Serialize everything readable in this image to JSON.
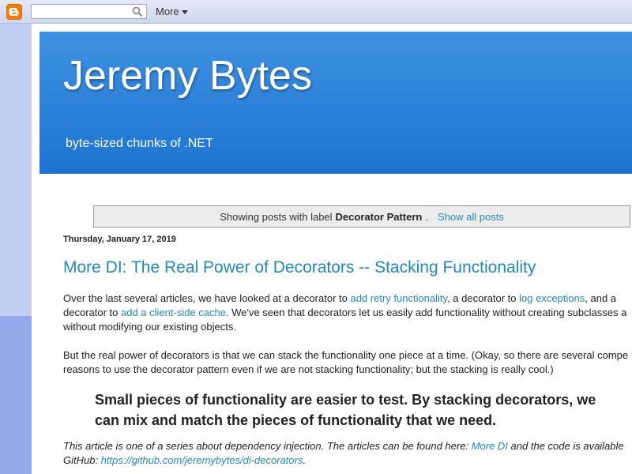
{
  "navbar": {
    "search_value": "",
    "more_label": "More"
  },
  "header": {
    "title": "Jeremy Bytes",
    "description": "byte-sized chunks of .NET"
  },
  "status": {
    "prefix": "Showing posts with label",
    "label": "Decorator Pattern",
    "suffix": ".",
    "show_all": "Show all posts"
  },
  "post": {
    "date": "Thursday, January 17, 2019",
    "title": "More DI: The Real Power of Decorators -- Stacking Functionality",
    "p1_a": "Over the last several articles, we have looked at a decorator to ",
    "p1_link1": "add retry functionality",
    "p1_b": ", a decorator to ",
    "p1_link2": "log exceptions",
    "p1_c": ", and a",
    "p1_d": "decorator to ",
    "p1_link3": "add a client-side cache",
    "p1_e": ". We've seen that decorators let us easily add functionality without creating subclasses a",
    "p1_f": "without modifying our existing objects.",
    "p2_a": "But the real power of decorators is that we can stack the functionality one piece at a time. (Okay, so there are several compe",
    "p2_b": "reasons to use the decorator pattern even if we are not stacking functionality; but the stacking is really cool.)",
    "callout_1": "Small pieces of functionality are easier to test. By stacking decorators, we",
    "callout_2": "can mix and match the pieces of functionality that we need.",
    "series_a": "This article is one of a series about dependency injection. The articles can be found here: ",
    "series_link": "More DI",
    "series_b": " and the code is available",
    "series_c": "GitHub: ",
    "series_url": "https://github.com/jeremybytes/di-decorators",
    "series_d": "."
  },
  "colors": {
    "header_blue": "#2a80d8",
    "link": "#2288bb",
    "blogger_orange": "#f57d00"
  }
}
